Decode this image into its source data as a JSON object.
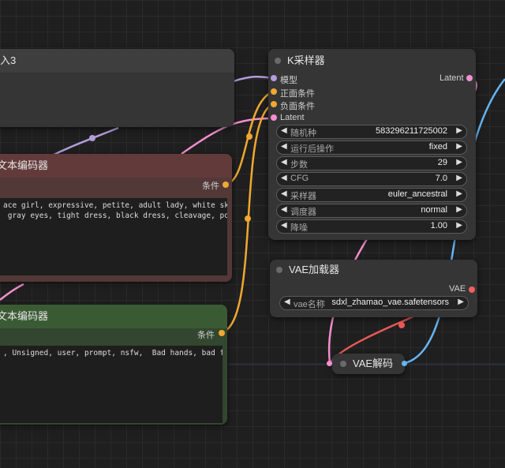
{
  "colors": {
    "model": "#b39ddb",
    "conditioning": "#f0a830",
    "latent": "#f48fd0",
    "vae": "#f06060",
    "image": "#64b5f6",
    "wire_red": "#e95858"
  },
  "top_left_node": {
    "title": "入3"
  },
  "pos_encoder": {
    "title": "文本编码器",
    "output_label": "条件",
    "text": "ace girl, expressive, petite, adult lady, white skin,\n gray eyes, tight dress, black dress, cleavage, portrait"
  },
  "neg_encoder": {
    "title": "文本编码器",
    "output_label": "条件",
    "text": ", Unsigned, user, prompt, nsfw,  Bad hands, bad face"
  },
  "ksampler": {
    "title": "K采样器",
    "inputs": [
      "模型",
      "正面条件",
      "负面条件",
      "Latent"
    ],
    "output_label": "Latent",
    "widgets": [
      {
        "label": "随机种",
        "value": "583296211725002"
      },
      {
        "label": "运行后操作",
        "value": "fixed"
      },
      {
        "label": "步数",
        "value": "29"
      },
      {
        "label": "CFG",
        "value": "7.0"
      },
      {
        "label": "采样器",
        "value": "euler_ancestral"
      },
      {
        "label": "调度器",
        "value": "normal"
      },
      {
        "label": "降噪",
        "value": "1.00"
      }
    ]
  },
  "vae_loader": {
    "title": "VAE加载器",
    "output_label": "VAE",
    "widget": {
      "label": "vae名称",
      "value": "sdxl_zhamao_vae.safetensors"
    }
  },
  "vae_decode": {
    "title": "VAE解码"
  },
  "icons": {
    "left_arrow": "◀",
    "right_arrow": "▶"
  }
}
